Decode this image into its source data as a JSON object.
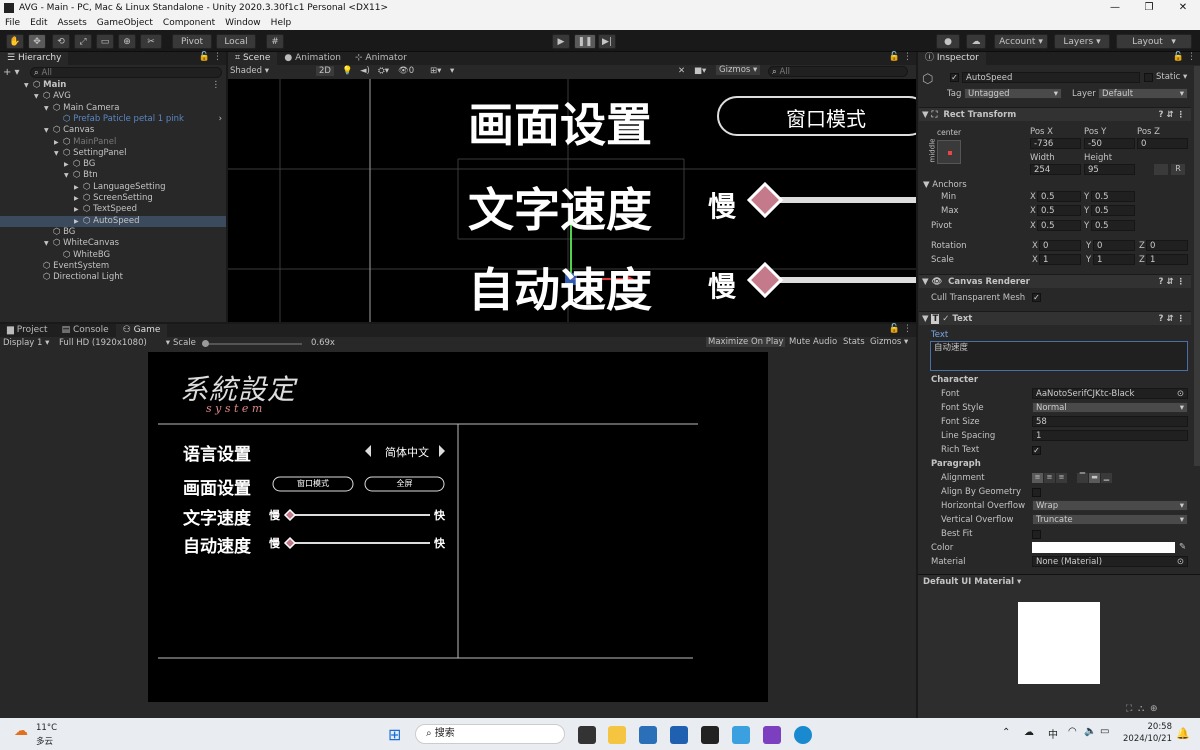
{
  "title": "AVG - Main - PC, Mac & Linux Standalone - Unity 2020.3.30f1c1 Personal <DX11>",
  "window_controls": {
    "minimize": "—",
    "maximize": "❐",
    "close": "✕"
  },
  "menu": [
    "File",
    "Edit",
    "Assets",
    "GameObject",
    "Component",
    "Window",
    "Help"
  ],
  "toolbar": {
    "pivot": "Pivot",
    "local": "Local",
    "account": "Account",
    "layers": "Layers",
    "layout": "Layout"
  },
  "hierarchy": {
    "tab": "Hierarchy",
    "search": "All",
    "items": [
      {
        "label": "Main",
        "indent": 0,
        "arrow": "▼",
        "bold": true
      },
      {
        "label": "AVG",
        "indent": 1,
        "arrow": "▼"
      },
      {
        "label": "Main Camera",
        "indent": 2,
        "arrow": "▼"
      },
      {
        "label": "Prefab Paticle petal 1 pink",
        "indent": 3,
        "arrow": "",
        "prefab": true
      },
      {
        "label": "Canvas",
        "indent": 2,
        "arrow": "▼"
      },
      {
        "label": "MainPanel",
        "indent": 3,
        "arrow": "▶",
        "dim": true
      },
      {
        "label": "SettingPanel",
        "indent": 3,
        "arrow": "▼"
      },
      {
        "label": "BG",
        "indent": 4,
        "arrow": "▶"
      },
      {
        "label": "Btn",
        "indent": 4,
        "arrow": "▼"
      },
      {
        "label": "LanguageSetting",
        "indent": 5,
        "arrow": "▶"
      },
      {
        "label": "ScreenSetting",
        "indent": 5,
        "arrow": "▶"
      },
      {
        "label": "TextSpeed",
        "indent": 5,
        "arrow": "▶"
      },
      {
        "label": "AutoSpeed",
        "indent": 5,
        "arrow": "▶",
        "selected": true
      },
      {
        "label": "BG",
        "indent": 2,
        "arrow": ""
      },
      {
        "label": "WhiteCanvas",
        "indent": 2,
        "arrow": "▼"
      },
      {
        "label": "WhiteBG",
        "indent": 3,
        "arrow": ""
      },
      {
        "label": "EventSystem",
        "indent": 1,
        "arrow": ""
      },
      {
        "label": "Directional Light",
        "indent": 1,
        "arrow": ""
      }
    ]
  },
  "scene": {
    "tabs": [
      "Scene",
      "Animation",
      "Animator"
    ],
    "shading": "Shaded",
    "mode2d": "2D",
    "gizmos": "Gizmos",
    "search": "All",
    "layers_count": "0",
    "text_screen": "画面设置",
    "text_window": "窗口模式",
    "text_textspeed": "文字速度",
    "text_autospeed": "自动速度",
    "slow": "慢"
  },
  "game": {
    "tabs": [
      "Project",
      "Console",
      "Game"
    ],
    "display": "Display 1",
    "resolution": "Full HD (1920x1080)",
    "scale_label": "Scale",
    "scale_value": "0.69x",
    "buttons": [
      "Maximize On Play",
      "Mute Audio",
      "Stats",
      "Gizmos"
    ],
    "logo": "系統設定",
    "logo_sub": "s y s t e m",
    "language_label": "语言设置",
    "language_value": "简体中文",
    "screen_label": "画面设置",
    "window_btn": "窗口模式",
    "full_btn": "全屏",
    "textspeed_label": "文字速度",
    "autospeed_label": "自动速度",
    "slow": "慢",
    "fast": "快"
  },
  "inspector": {
    "tab": "Inspector",
    "object_name": "AutoSpeed",
    "static": "Static",
    "tag_label": "Tag",
    "tag": "Untagged",
    "layer_label": "Layer",
    "layer": "Default",
    "rect_transform": "Rect Transform",
    "anchor_h": "center",
    "anchor_v": "middle",
    "pos_x_label": "Pos X",
    "pos_y_label": "Pos Y",
    "pos_z_label": "Pos Z",
    "pos_x": "-736",
    "pos_y": "-50",
    "pos_z": "0",
    "width_label": "Width",
    "height_label": "Height",
    "width": "254",
    "height": "95",
    "anchors": "Anchors",
    "min": "Min",
    "max": "Max",
    "pivot": "Pivot",
    "rotation": "Rotation",
    "scale": "Scale",
    "min_x": "0.5",
    "min_y": "0.5",
    "max_x": "0.5",
    "max_y": "0.5",
    "pivot_x": "0.5",
    "pivot_y": "0.5",
    "rot_x": "0",
    "rot_y": "0",
    "rot_z": "0",
    "scale_x": "1",
    "scale_y": "1",
    "scale_z": "1",
    "canvas_renderer": "Canvas Renderer",
    "cull": "Cull Transparent Mesh",
    "text_comp": "Text",
    "text_label": "Text",
    "text_value": "自动速度",
    "character": "Character",
    "font_label": "Font",
    "font": "NotoSerifCJKtc-Black",
    "font_style_label": "Font Style",
    "font_style": "Normal",
    "font_size_label": "Font Size",
    "font_size": "58",
    "line_spacing_label": "Line Spacing",
    "line_spacing": "1",
    "rich_text": "Rich Text",
    "paragraph": "Paragraph",
    "alignment": "Alignment",
    "align_geometry": "Align By Geometry",
    "h_overflow_label": "Horizontal Overflow",
    "h_overflow": "Wrap",
    "v_overflow_label": "Vertical Overflow",
    "v_overflow": "Truncate",
    "best_fit": "Best Fit",
    "color": "Color",
    "material_label": "Material",
    "material": "None (Material)",
    "preview_title": "Default UI Material"
  },
  "taskbar": {
    "temp": "11°C",
    "weather": "多云",
    "search": "搜索",
    "ime": "中",
    "time": "20:58",
    "date": "2024/10/21"
  }
}
